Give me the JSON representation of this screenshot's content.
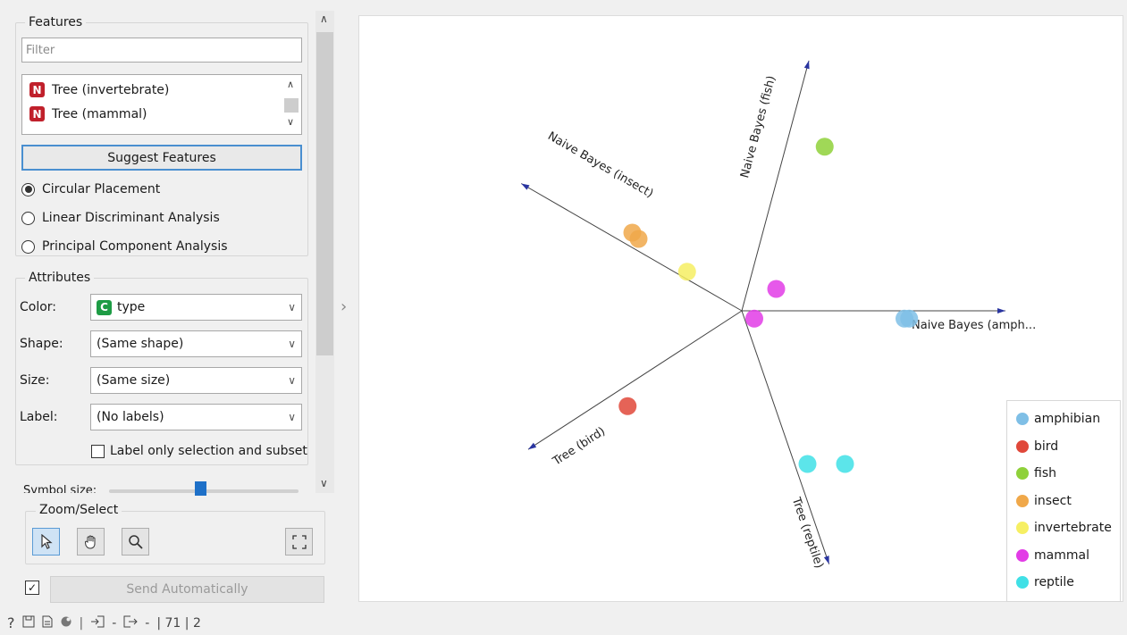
{
  "features": {
    "title": "Features",
    "filter_placeholder": "Filter",
    "items": [
      {
        "badge": "N",
        "label": "Tree (invertebrate)"
      },
      {
        "badge": "N",
        "label": "Tree (mammal)"
      }
    ],
    "suggest_label": "Suggest Features",
    "placements": [
      {
        "label": "Circular Placement",
        "selected": true
      },
      {
        "label": "Linear Discriminant Analysis",
        "selected": false
      },
      {
        "label": "Principal Component Analysis",
        "selected": false
      }
    ]
  },
  "attributes": {
    "title": "Attributes",
    "color": {
      "label": "Color:",
      "badge": "C",
      "value": "type"
    },
    "shape": {
      "label": "Shape:",
      "value": "(Same shape)"
    },
    "size": {
      "label": "Size:",
      "value": "(Same size)"
    },
    "label": {
      "label": "Label:",
      "value": "(No labels)"
    },
    "label_only_selection": {
      "label": "Label only selection and subset",
      "checked": false
    }
  },
  "symbol_size": {
    "label": "Symbol size:",
    "value": 0.48
  },
  "zoom": {
    "title": "Zoom/Select",
    "tools": [
      "pointer-icon",
      "hand-icon",
      "magnifier-icon"
    ],
    "fit_icon": "fit-screen-icon"
  },
  "send": {
    "label": "Send Automatically",
    "checked": true
  },
  "status": {
    "count_text": "| 71 | 2"
  },
  "plot": {
    "axes": [
      {
        "label": "Naive Bayes (fish)",
        "angle": -75
      },
      {
        "label": "Naive Bayes (insect)",
        "angle": -150
      },
      {
        "label": "Naive Bayes (amph...",
        "angle": 0
      },
      {
        "label": "Tree (bird)",
        "angle": 147
      },
      {
        "label": "Tree (reptile)",
        "angle": 71
      }
    ],
    "points": [
      {
        "cls": "fish",
        "ax": 0.53,
        "ay": 1.05
      },
      {
        "cls": "insect",
        "ax": -0.7,
        "ay": 0.5
      },
      {
        "cls": "insect",
        "ax": -0.66,
        "ay": 0.46
      },
      {
        "cls": "invertebrate",
        "ax": -0.35,
        "ay": 0.25
      },
      {
        "cls": "mammal",
        "ax": 0.22,
        "ay": 0.14
      },
      {
        "cls": "mammal",
        "ax": 0.08,
        "ay": -0.05
      },
      {
        "cls": "amphibian",
        "ax": 1.04,
        "ay": -0.05
      },
      {
        "cls": "amphibian",
        "ax": 1.07,
        "ay": -0.05
      },
      {
        "cls": "bird",
        "ax": -0.73,
        "ay": -0.61
      },
      {
        "cls": "reptile",
        "ax": 0.42,
        "ay": -0.98
      },
      {
        "cls": "reptile",
        "ax": 0.66,
        "ay": -0.98
      }
    ],
    "colors": {
      "amphibian": "#7fbfe6",
      "bird": "#e0483a",
      "fish": "#8fd13a",
      "insect": "#f0a84a",
      "invertebrate": "#f6ef63",
      "mammal": "#e23ce6",
      "reptile": "#40e0e6"
    },
    "legend": [
      "amphibian",
      "bird",
      "fish",
      "insect",
      "invertebrate",
      "mammal",
      "reptile"
    ]
  }
}
